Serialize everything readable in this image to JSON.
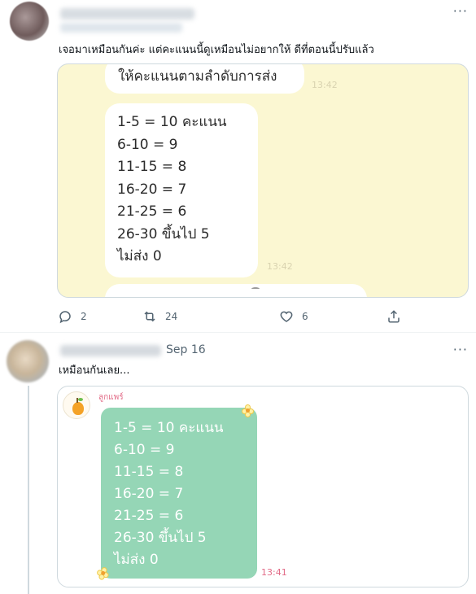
{
  "tweet1": {
    "more_label": "···",
    "text": "เจอมาเหมือนกันค่ะ แต่คะแนนนี้ดูเหมือนไม่อยากให้ ดีที่ตอนนี้ปรับแล้ว",
    "image": {
      "top_bubble_text": "ให้คะแนนตามลำดับการส่ง",
      "top_bubble_time": "13:42",
      "score_lines": [
        "1-5     = 10  คะแนน",
        "6-10   = 9",
        "11-15 = 8",
        "16-20 = 7",
        "21-25 = 6",
        "26-30 ขึ้นไป  5",
        "ไม่ส่ง  0"
      ],
      "score_time": "13:42"
    },
    "actions": {
      "reply_count": "2",
      "retweet_count": "24",
      "like_count": "6",
      "reply_icon": "reply-icon",
      "retweet_icon": "retweet-icon",
      "like_icon": "heart-icon",
      "share_icon": "share-icon"
    }
  },
  "tweet2": {
    "date": "Sep 16",
    "more_label": "···",
    "text": "เหมือนกันเลย...",
    "image": {
      "sender_name": "ลูกแพร์",
      "score_lines": [
        "1-5     = 10  คะแนน",
        "6-10   = 9",
        "11-15 = 8",
        "16-20 = 7",
        "21-25 = 6",
        "26-30 ขึ้นไป  5",
        "ไม่ส่ง  0"
      ],
      "time": "13:41"
    }
  },
  "colors": {
    "text": "#0f1419",
    "muted": "#536471",
    "border": "#cfd9de",
    "chat_bg_yellow": "#fbf7d2",
    "line_green": "#95d6b6",
    "line_name_pink": "#e26b87"
  }
}
